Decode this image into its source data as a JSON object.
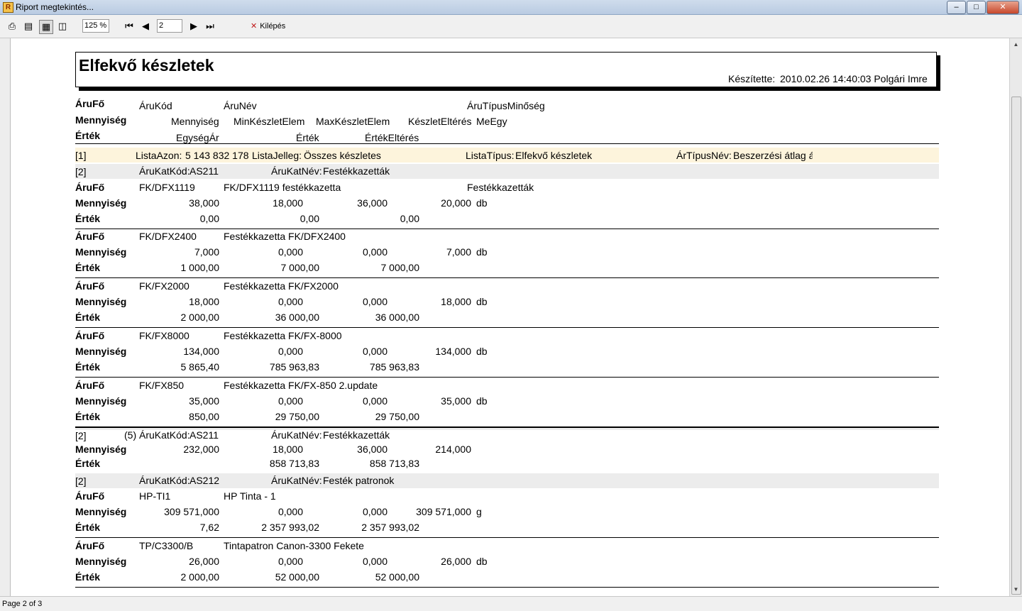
{
  "window": {
    "title": "Riport megtekintés...",
    "min": "–",
    "max": "□",
    "close": "✕"
  },
  "toolbar": {
    "zoom": "125 %",
    "page_input": "2",
    "exit_label": "Kilépés"
  },
  "status": {
    "page_text": "Page 2 of 3"
  },
  "report": {
    "title": "Elfekvő készletek",
    "created_label": "Készítette:",
    "created_value": "2010.02.26 14:40:03 Polgári Imre",
    "header": {
      "r1": {
        "label": "ÁruFő",
        "c1": "ÁruKód",
        "c2": "ÁruNév",
        "c3": "ÁruTípusMinőség"
      },
      "r2": {
        "label": "Mennyiség",
        "c1": "Mennyiség",
        "c2": "MinKészletElem",
        "c3": "MaxKészletElem",
        "c4": "KészletEltérés",
        "c5": "MeEgy"
      },
      "r3": {
        "label": "Érték",
        "c1": "EgységÁr",
        "c2": "Érték",
        "c3": "ÉrtékEltérés"
      }
    },
    "list_band": {
      "index": "[1]",
      "lista_azon": "ListaAzon:",
      "lista_azon_val": "5 143 832 178",
      "lista_jelleg": "ListaJelleg:",
      "lista_jelleg_val": "Összes készletes",
      "lista_tipus": "ListaTípus:",
      "lista_tipus_val": "Elfekvő készletek",
      "ar_tipus": "ÁrTípusNév:",
      "ar_tipus_val": "Beszerzési átlag á"
    },
    "groups": [
      {
        "index": "[2]",
        "kod_label": "ÁruKatKód:",
        "kod": "AS211",
        "nev_label": "ÁruKatNév:",
        "nev": "Festékkazetták"
      },
      {
        "index": "[2]",
        "kod_label": "ÁruKatKód:",
        "kod": "AS212",
        "nev_label": "ÁruKatNév:",
        "nev": "Festék patronok"
      }
    ],
    "row_labels": {
      "aru": "ÁruFő",
      "menny": "Mennyiség",
      "ertek": "Érték"
    },
    "items": [
      {
        "kod": "FK/DFX1119",
        "nev": "FK/DFX1119 festékkazetta",
        "tipus": "Festékkazetták",
        "menny": "38,000",
        "min": "18,000",
        "max": "36,000",
        "elt": "20,000",
        "me": "db",
        "egysegar": "0,00",
        "ertek": "0,00",
        "ertek_elt": "0,00"
      },
      {
        "kod": "FK/DFX2400",
        "nev": "Festékkazetta FK/DFX2400",
        "tipus": "",
        "menny": "7,000",
        "min": "0,000",
        "max": "0,000",
        "elt": "7,000",
        "me": "db",
        "egysegar": "1 000,00",
        "ertek": "7 000,00",
        "ertek_elt": "7 000,00"
      },
      {
        "kod": "FK/FX2000",
        "nev": "Festékkazetta FK/FX2000",
        "tipus": "",
        "menny": "18,000",
        "min": "0,000",
        "max": "0,000",
        "elt": "18,000",
        "me": "db",
        "egysegar": "2 000,00",
        "ertek": "36 000,00",
        "ertek_elt": "36 000,00"
      },
      {
        "kod": "FK/FX8000",
        "nev": "Festékkazetta FK/FX-8000",
        "tipus": "",
        "menny": "134,000",
        "min": "0,000",
        "max": "0,000",
        "elt": "134,000",
        "me": "db",
        "egysegar": "5 865,40",
        "ertek": "785 963,83",
        "ertek_elt": "785 963,83"
      },
      {
        "kod": "FK/FX850",
        "nev": "Festékkazetta FK/FX-850 2.update",
        "tipus": "",
        "menny": "35,000",
        "min": "0,000",
        "max": "0,000",
        "elt": "35,000",
        "me": "db",
        "egysegar": "850,00",
        "ertek": "29 750,00",
        "ertek_elt": "29 750,00"
      },
      {
        "kod": "HP-TI1",
        "nev": "HP Tinta - 1",
        "tipus": "",
        "menny": "309 571,000",
        "min": "0,000",
        "max": "0,000",
        "elt": "309 571,000",
        "me": "g",
        "egysegar": "7,62",
        "ertek": "2 357 993,02",
        "ertek_elt": "2 357 993,02"
      },
      {
        "kod": "TP/C3300/B",
        "nev": "Tintapatron Canon-3300 Fekete",
        "tipus": "",
        "menny": "26,000",
        "min": "0,000",
        "max": "0,000",
        "elt": "26,000",
        "me": "db",
        "egysegar": "2 000,00",
        "ertek": "52 000,00",
        "ertek_elt": "52 000,00"
      }
    ],
    "group_summary": {
      "index": "[2]",
      "count": "(5)",
      "kod_label": "ÁruKatKód:",
      "kod": "AS211",
      "nev_label": "ÁruKatNév:",
      "nev": "Festékkazetták",
      "menny": "232,000",
      "min": "18,000",
      "max": "36,000",
      "elt": "214,000",
      "ertek": "858 713,83",
      "ertek_elt": "858 713,83"
    }
  }
}
